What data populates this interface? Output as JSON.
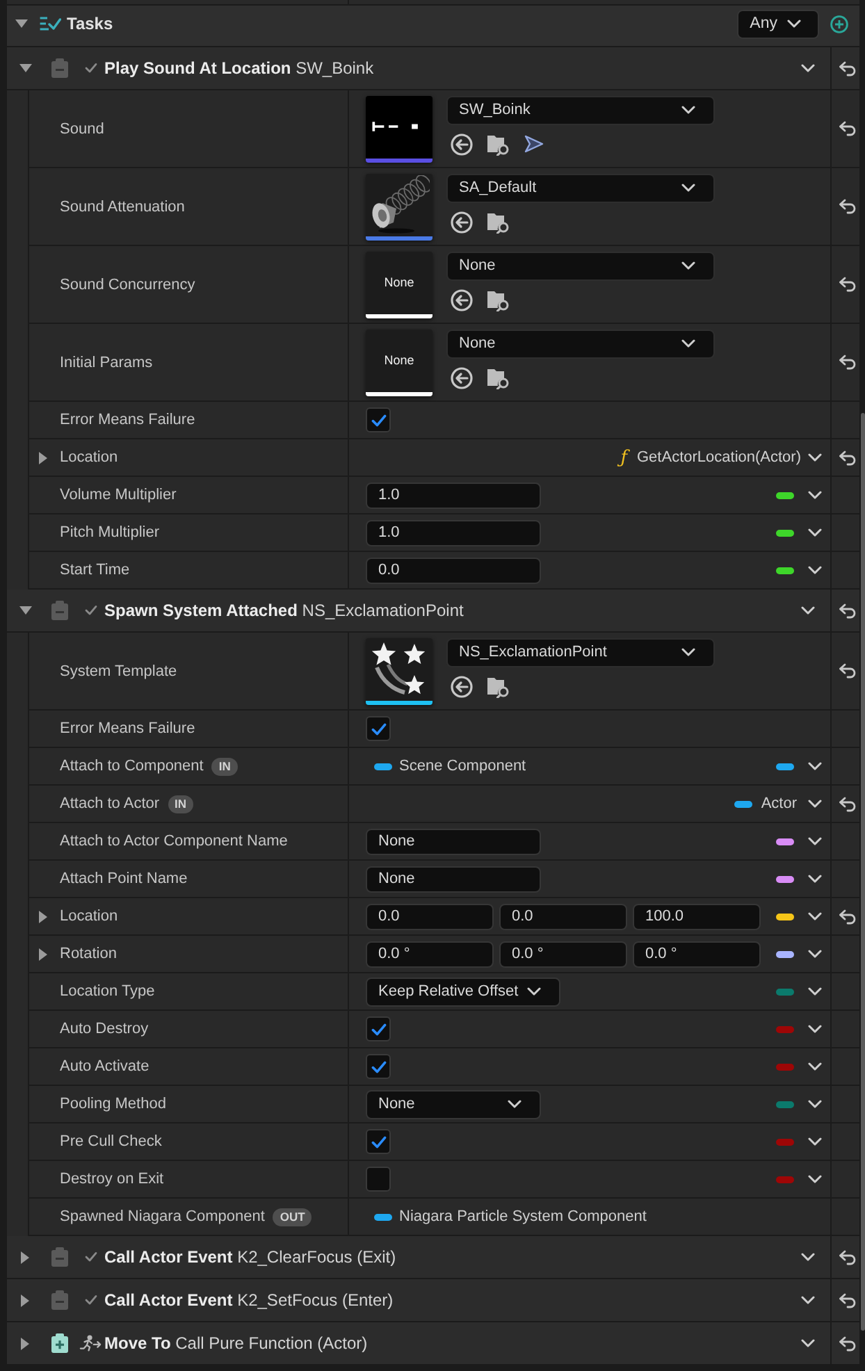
{
  "category": {
    "title": "Tasks",
    "expanded": true,
    "filter": "Any"
  },
  "tasks": [
    {
      "kind": "task",
      "expanded": true,
      "title": "**Play Sound At Location** SW_Boink",
      "properties": [
        {
          "kind": "asset",
          "name": "Sound",
          "value": "SW_Boink",
          "thumbnail": {
            "kind": "waveform",
            "color": "#5a4fe3"
          },
          "playable": true,
          "resettable": true
        },
        {
          "kind": "asset",
          "name": "Sound Attenuation",
          "value": "SA_Default",
          "thumbnail": {
            "kind": "speaker",
            "color": "#4a7ae6"
          },
          "playable": false,
          "resettable": true
        },
        {
          "kind": "asset",
          "name": "Sound Concurrency",
          "value": "None",
          "thumbnail": {
            "kind": "empty",
            "label": "None",
            "color": "#ffffff"
          },
          "playable": false,
          "resettable": true
        },
        {
          "kind": "asset",
          "name": "Initial Params",
          "value": "None",
          "thumbnail": {
            "kind": "empty",
            "label": "None",
            "color": "#ffffff"
          },
          "playable": false,
          "resettable": true
        },
        {
          "kind": "checkbox",
          "name": "Error Means Failure",
          "checked": true,
          "resettable": false
        },
        {
          "kind": "function_binding",
          "name": "Location",
          "expanded": false,
          "symbol": "ƒ",
          "value": "GetActorLocation(Actor)",
          "resettable": true
        },
        {
          "kind": "number",
          "name": "Volume Multiplier",
          "value": "1.0",
          "color": "#3ed62a",
          "resettable": false
        },
        {
          "kind": "number",
          "name": "Pitch Multiplier",
          "value": "1.0",
          "color": "#3ed62a",
          "resettable": false
        },
        {
          "kind": "number",
          "name": "Start Time",
          "value": "0.0",
          "color": "#3ed62a",
          "resettable": false
        }
      ]
    },
    {
      "kind": "task",
      "expanded": true,
      "title": "**Spawn System Attached** NS_ExclamationPoint",
      "properties": [
        {
          "kind": "asset",
          "name": "System Template",
          "value": "NS_ExclamationPoint",
          "thumbnail": {
            "kind": "particles",
            "color": "#1ec0f2"
          },
          "playable": false,
          "resettable": true
        },
        {
          "kind": "checkbox",
          "name": "Error Means Failure",
          "checked": true,
          "resettable": false
        },
        {
          "kind": "object",
          "name": "Attach to Component",
          "badge": "IN",
          "value": "Scene Component",
          "color": "#1ea8f0",
          "resettable": false
        },
        {
          "kind": "pin_binding",
          "name": "Attach to Actor",
          "badge": "IN",
          "value": "Actor",
          "color": "#1ea8f0",
          "resettable": true
        },
        {
          "kind": "text",
          "name": "Attach to Actor Component Name",
          "value": "None",
          "color": "#d88cf5",
          "resettable": false
        },
        {
          "kind": "text",
          "name": "Attach Point Name",
          "value": "None",
          "color": "#d88cf5",
          "resettable": false
        },
        {
          "kind": "vector",
          "name": "Location",
          "expanded": false,
          "values": [
            "0.0",
            "0.0",
            "100.0"
          ],
          "color": "#f5c518",
          "resettable": true
        },
        {
          "kind": "vector",
          "name": "Rotation",
          "expanded": false,
          "values": [
            "0.0 °",
            "0.0 °",
            "0.0 °"
          ],
          "color": "#a8b4ff",
          "resettable": false
        },
        {
          "kind": "enum",
          "name": "Location Type",
          "value": "Keep Relative Offset",
          "color": "#0b7a6c",
          "resettable": false
        },
        {
          "kind": "checkbox",
          "name": "Auto Destroy",
          "checked": true,
          "color": "#9e0606",
          "resettable": false
        },
        {
          "kind": "checkbox",
          "name": "Auto Activate",
          "checked": true,
          "color": "#9e0606",
          "resettable": false
        },
        {
          "kind": "enum",
          "name": "Pooling Method",
          "value": "None",
          "color": "#0b7a6c",
          "resettable": false
        },
        {
          "kind": "checkbox",
          "name": "Pre Cull Check",
          "checked": true,
          "color": "#9e0606",
          "resettable": false
        },
        {
          "kind": "checkbox",
          "name": "Destroy on Exit",
          "checked": false,
          "color": "#9e0606",
          "resettable": false
        },
        {
          "kind": "output",
          "name": "Spawned Niagara Component",
          "badge": "OUT",
          "value": "Niagara Particle System Component",
          "color": "#1ea8f0",
          "resettable": false
        }
      ]
    },
    {
      "kind": "task",
      "expanded": false,
      "title": "**Call Actor Event** K2_ClearFocus (Exit)"
    },
    {
      "kind": "task",
      "expanded": false,
      "title": "**Call Actor Event** K2_SetFocus (Enter)"
    },
    {
      "kind": "move",
      "expanded": false,
      "title": "**Move To** Call Pure Function (Actor)"
    }
  ]
}
